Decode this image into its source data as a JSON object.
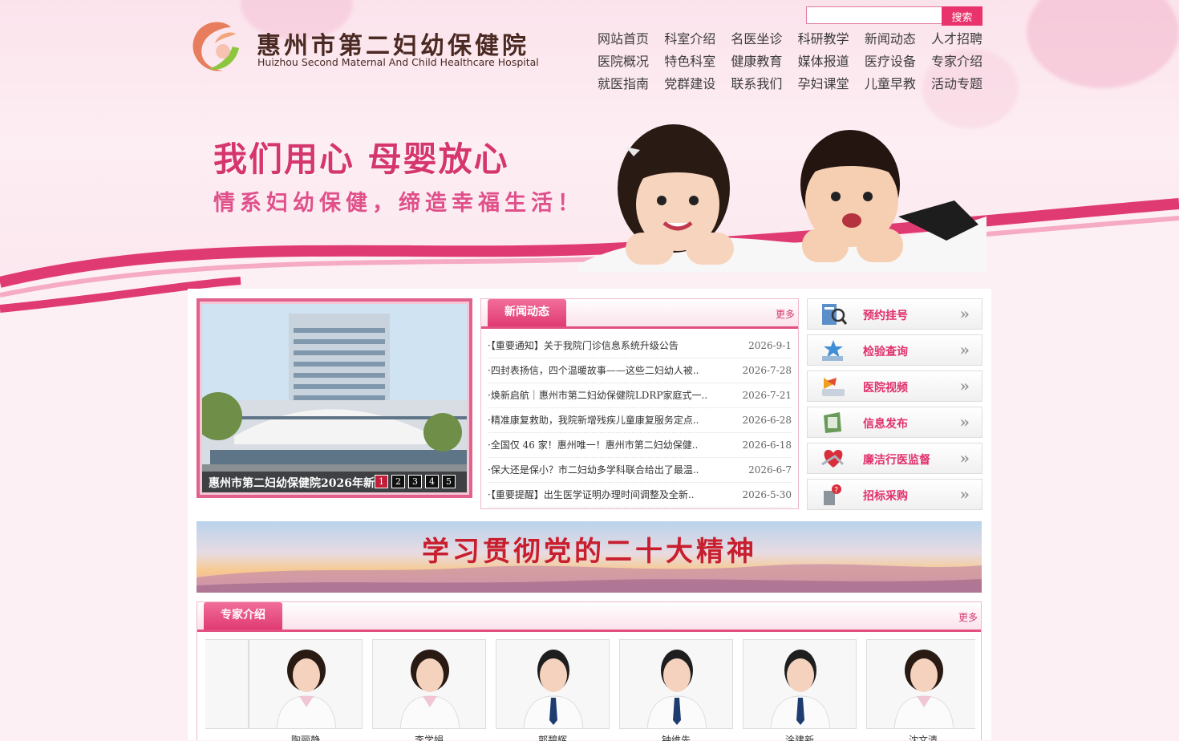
{
  "header": {
    "logo_cn": "惠州市第二妇幼保健院",
    "logo_en": "Huizhou Second Maternal And Child Healthcare Hospital",
    "search": {
      "placeholder": "",
      "button": "搜索"
    },
    "nav": [
      [
        "网站首页",
        "科室介绍",
        "名医坐诊",
        "科研教学",
        "新闻动态",
        "人才招聘"
      ],
      [
        "医院概况",
        "特色科室",
        "健康教育",
        "媒体报道",
        "医疗设备",
        "专家介绍"
      ],
      [
        "就医指南",
        "党群建设",
        "联系我们",
        "孕妇课堂",
        "儿童早教",
        "活动专题"
      ]
    ]
  },
  "banner": {
    "slogan1": "我们用心  母婴放心",
    "slogan2": "情系妇幼保健，缔造幸福生活！"
  },
  "carousel": {
    "caption": "惠州市第二妇幼保健院2026年新..",
    "pages": [
      "1",
      "2",
      "3",
      "4",
      "5"
    ],
    "active_page": 1
  },
  "news": {
    "tab": "新闻动态",
    "more": "更多",
    "items": [
      {
        "title": "·【重要通知】关于我院门诊信息系统升级公告",
        "date": "2026-9-1"
      },
      {
        "title": "·四封表扬信，四个温暖故事——这些二妇幼人被..",
        "date": "2026-7-28"
      },
      {
        "title": "·焕新启航｜惠州市第二妇幼保健院LDRP家庭式一..",
        "date": "2026-7-21"
      },
      {
        "title": "·精准康复救助，我院新增残疾儿童康复服务定点..",
        "date": "2026-6-28"
      },
      {
        "title": "·全国仅 46 家！惠州唯一！惠州市第二妇幼保健..",
        "date": "2026-6-18"
      },
      {
        "title": "·保大还是保小？市二妇幼多学科联合给出了最温..",
        "date": "2026-6-7"
      },
      {
        "title": "·【重要提醒】出生医学证明办理时间调整及全新..",
        "date": "2026-5-30"
      }
    ]
  },
  "side_buttons": [
    {
      "label": "预约挂号",
      "icon": "appointment-icon"
    },
    {
      "label": "检验查询",
      "icon": "lab-query-icon"
    },
    {
      "label": "医院视频",
      "icon": "video-icon"
    },
    {
      "label": "信息发布",
      "icon": "info-publish-icon"
    },
    {
      "label": "廉洁行医监督",
      "icon": "supervision-icon"
    },
    {
      "label": "招标采购",
      "icon": "procurement-icon"
    }
  ],
  "side_arrow": "»",
  "party_banner": {
    "text": "学习贯彻党的二十大精神"
  },
  "experts": {
    "tab": "专家介绍",
    "more": "更多",
    "items": [
      {
        "name": "陶丽静",
        "gender": "f"
      },
      {
        "name": "李学娟",
        "gender": "f"
      },
      {
        "name": "郭碧辉",
        "gender": "m"
      },
      {
        "name": "钟维先",
        "gender": "m"
      },
      {
        "name": "涂建新",
        "gender": "m"
      },
      {
        "name": "沈文清",
        "gender": "f"
      }
    ]
  },
  "colors": {
    "accent": "#e2507f",
    "brand_pink": "#e03a72",
    "title_red": "#c81e2d"
  }
}
